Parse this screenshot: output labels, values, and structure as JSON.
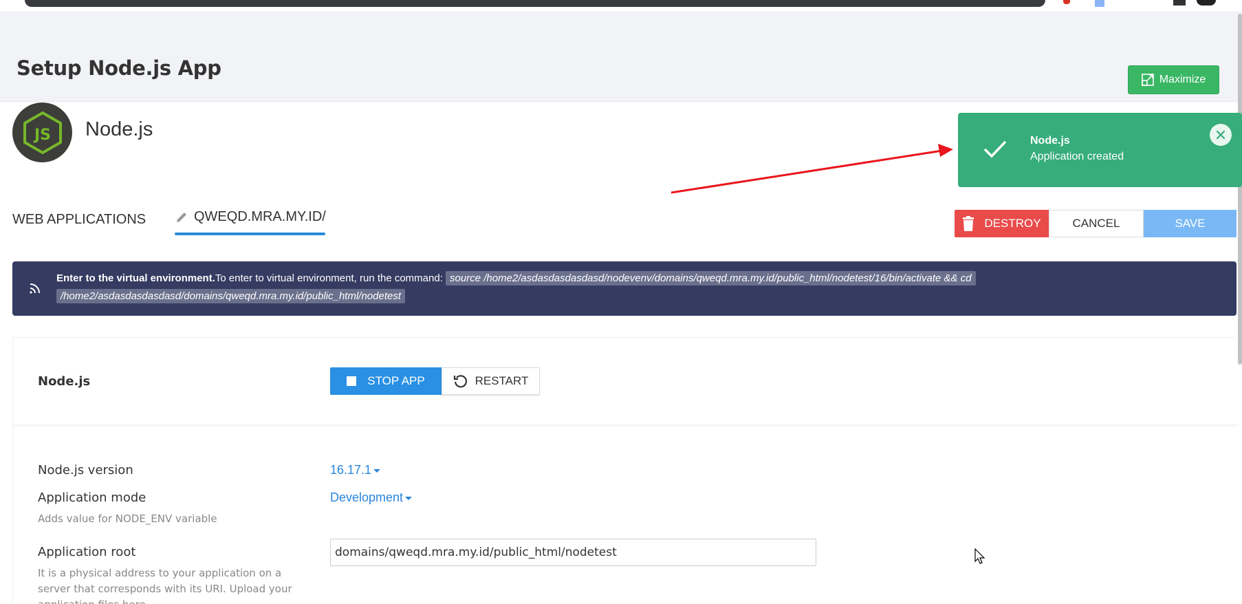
{
  "header": {
    "title": "Setup Node.js App",
    "maximize_label": "Maximize"
  },
  "app": {
    "name": "Node.js",
    "logo_text": "JS"
  },
  "toast": {
    "title": "Node.js",
    "message": "Application created",
    "color": "#36ad7a"
  },
  "tabs": {
    "web_applications": "WEB APPLICATIONS",
    "current_app": "QWEQD.MRA.MY.ID/"
  },
  "actions": {
    "destroy": "DESTROY",
    "cancel": "CANCEL",
    "save": "SAVE"
  },
  "env_banner": {
    "heading": "Enter to the virtual environment.",
    "text": "To enter to virtual environment, run the command:",
    "command": "source /home2/asdasdasdasdasd/nodevenv/domains/qweqd.mra.my.id/public_html/nodetest/16/bin/activate && cd /home2/asdasdasdasdasd/domains/qweqd.mra.my.id/public_html/nodetest"
  },
  "controls": {
    "section_label": "Node.js",
    "stop_label": "STOP APP",
    "restart_label": "RESTART"
  },
  "fields": {
    "version_label": "Node.js version",
    "version_value": "16.17.1",
    "mode_label": "Application mode",
    "mode_value": "Development",
    "mode_help": "Adds value for NODE_ENV variable",
    "root_label": "Application root",
    "root_value": "domains/qweqd.mra.my.id/public_html/nodetest",
    "root_help": "It is a physical address to your application on a server that corresponds with its URI. Upload your application files here"
  },
  "colors": {
    "accent": "#2a90e4",
    "success": "#3ab764",
    "danger": "#e94b4b",
    "banner": "#353b61"
  }
}
